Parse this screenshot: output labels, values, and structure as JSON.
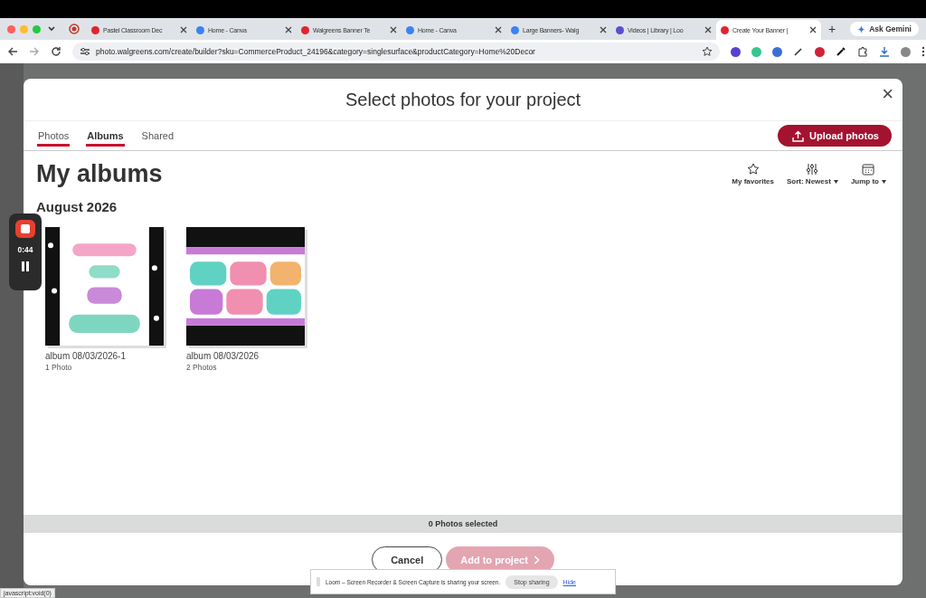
{
  "browser": {
    "tabs": [
      {
        "title": "Pastel Classroom Dec",
        "selected": false,
        "kind": "walgreens"
      },
      {
        "title": "Home - Canva",
        "selected": false,
        "kind": "canva"
      },
      {
        "title": "Walgreens Banner Te",
        "selected": false,
        "kind": "walgreens"
      },
      {
        "title": "Home - Canva",
        "selected": false,
        "kind": "canva"
      },
      {
        "title": "Large Banners- Walg",
        "selected": false,
        "kind": "canva"
      },
      {
        "title": "Videos | Library | Loo",
        "selected": false,
        "kind": "loom"
      },
      {
        "title": "Create Your Banner |",
        "selected": true,
        "kind": "walgreens"
      }
    ],
    "new_tab": "+",
    "gemini": "Ask Gemini",
    "url": "photo.walgreens.com/create/builder?sku=CommerceProduct_24196&category=singlesurface&productCategory=Home%20Decor",
    "status": "javascript:void(0)"
  },
  "recorder": {
    "time": "0:44"
  },
  "dialog": {
    "title": "Select photos for your project",
    "close": "×",
    "tabs": [
      {
        "label": "Photos",
        "selected": false,
        "underlined": true
      },
      {
        "label": "Albums",
        "selected": true,
        "underlined": true
      },
      {
        "label": "Shared",
        "selected": false,
        "underlined": false
      }
    ],
    "upload": "Upload photos",
    "heading": "My albums",
    "tools": [
      {
        "label": "My favorites",
        "kind": "star",
        "dropdown": false
      },
      {
        "label": "Sort: Newest",
        "kind": "sort",
        "dropdown": true
      },
      {
        "label": "Jump to",
        "kind": "calendar",
        "dropdown": true
      }
    ],
    "group": "August 2026",
    "albums": [
      {
        "name": "album 08/03/2026-1",
        "count": "1 Photo",
        "kind": "picture"
      },
      {
        "name": "album 08/03/2026",
        "count": "2 Photos",
        "kind": "picture"
      }
    ],
    "selected_count": "0 Photos selected",
    "cancel": "Cancel",
    "add": "Add to project",
    "add_disabled": true
  },
  "loom": {
    "message": "Loom – Screen Recorder & Screen Capture is sharing your screen.",
    "stop": "Stop sharing",
    "hide": "Hide"
  }
}
